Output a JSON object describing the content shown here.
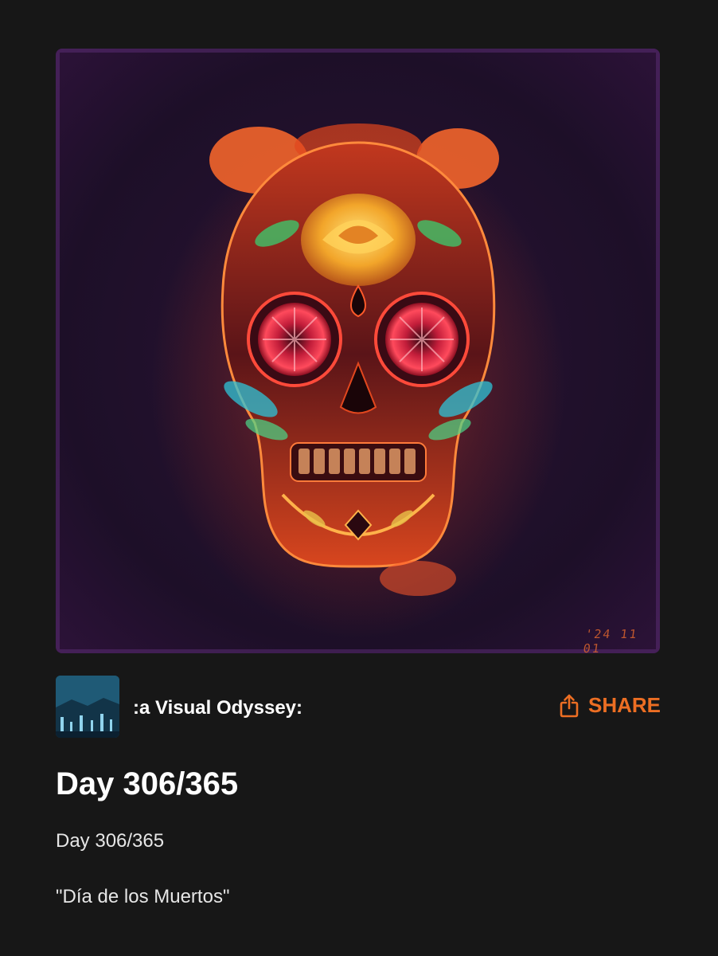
{
  "artwork": {
    "alt": "Sugar skull artwork",
    "stamp": "'24 11 01"
  },
  "channel": {
    "name": ":a Visual Odyssey:",
    "avatar_icon": "channel-avatar-image"
  },
  "share": {
    "label": "SHARE",
    "icon": "share-icon",
    "color": "#ec6e23"
  },
  "post": {
    "title": "Day 306/365",
    "body_lines": [
      "Day 306/365",
      "\"Día de los Muertos\""
    ]
  }
}
